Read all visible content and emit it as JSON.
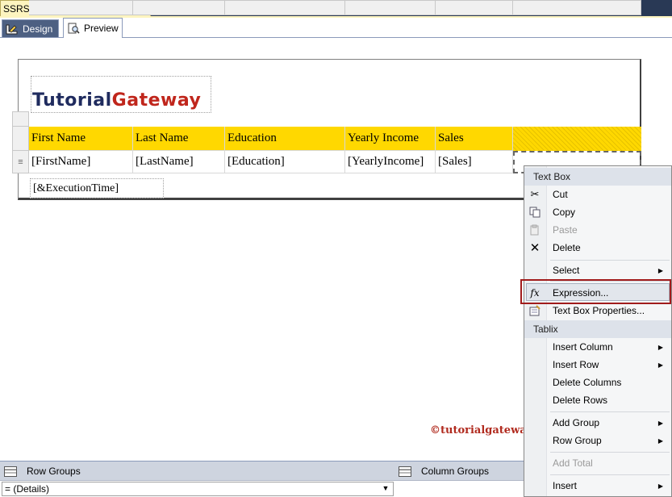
{
  "document_tab": {
    "title": "SSRS Lookup.rdl [Design]*",
    "pin": "⇥",
    "close": "✕"
  },
  "view_tabs": [
    {
      "label": "Design",
      "active": true
    },
    {
      "label": "Preview",
      "active": false
    }
  ],
  "report": {
    "logo": {
      "part1": "Tutorial",
      "part2": "Gateway"
    },
    "headers": [
      "First Name",
      "Last Name",
      "Education",
      "Yearly Income",
      "Sales",
      ""
    ],
    "details": [
      "[FirstName]",
      "[LastName]",
      "[Education]",
      "[YearlyIncome]",
      "[Sales]",
      ""
    ],
    "row_handle_glyph": "≡",
    "execution_time": "[&ExecutionTime]"
  },
  "watermark": "©tutorialgateway.org",
  "context_menu": {
    "textbox_header": "Text Box",
    "cut": "Cut",
    "copy": "Copy",
    "paste": "Paste",
    "delete": "Delete",
    "select": "Select",
    "expression": "Expression...",
    "textbox_properties": "Text Box Properties...",
    "tablix_header": "Tablix",
    "insert_column": "Insert Column",
    "insert_row": "Insert Row",
    "delete_columns": "Delete Columns",
    "delete_rows": "Delete Rows",
    "add_group": "Add Group",
    "row_group": "Row Group",
    "add_total": "Add Total",
    "insert": "Insert"
  },
  "group_pane": {
    "row_groups": "Row Groups",
    "column_groups": "Column Groups",
    "details_value": "= (Details)"
  },
  "colors": {
    "header_fill": "#ffd800",
    "highlight": "#a11c1c",
    "tab_strip": "#293955"
  }
}
